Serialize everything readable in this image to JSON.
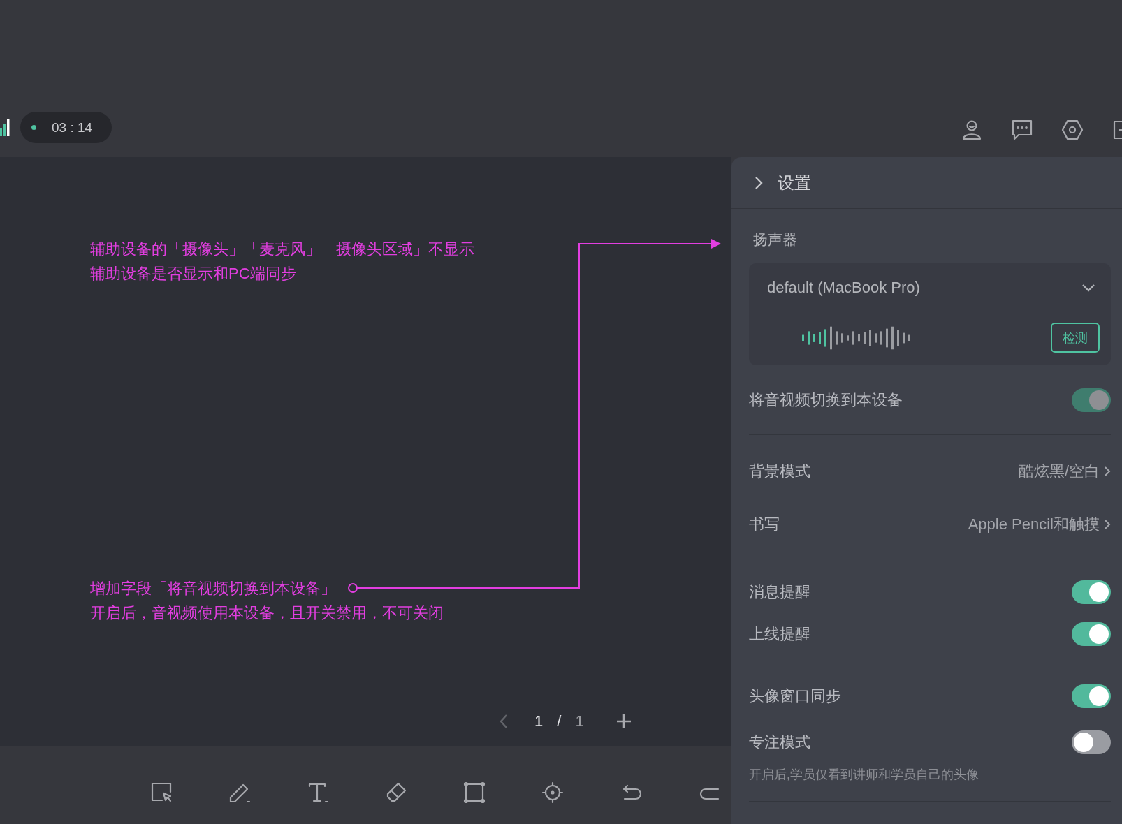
{
  "timer": {
    "time": "03 : 14"
  },
  "annotations": [
    {
      "lines": [
        "辅助设备的「摄像头」「麦克风」「摄像头区域」不显示",
        "辅助设备是否显示和PC端同步"
      ]
    },
    {
      "lines": [
        "增加字段「将音视频切换到本设备」",
        "开启后，音视频使用本设备，且开关禁用，不可关闭"
      ]
    }
  ],
  "pager": {
    "current": "1",
    "separator": "/",
    "total": "1"
  },
  "settings": {
    "title": "设置",
    "speaker": {
      "label": "扬声器",
      "device": "default (MacBook Pro)",
      "test_button": "检测"
    },
    "sections": [
      {
        "rows": [
          {
            "kind": "toggle",
            "label": "将音视频切换到本设备",
            "on": true,
            "disabled": true
          }
        ]
      },
      {
        "rows": [
          {
            "kind": "link",
            "label": "背景模式",
            "value": "酷炫黑/空白"
          },
          {
            "kind": "link",
            "label": "书写",
            "value": "Apple Pencil和触摸"
          }
        ]
      },
      {
        "rows": [
          {
            "kind": "toggle",
            "label": "消息提醒",
            "on": true,
            "disabled": false
          },
          {
            "kind": "toggle",
            "label": "上线提醒",
            "on": true,
            "disabled": false
          }
        ]
      },
      {
        "rows": [
          {
            "kind": "toggle",
            "label": "头像窗口同步",
            "on": true,
            "disabled": false
          },
          {
            "kind": "toggle",
            "label": "专注模式",
            "on": false,
            "disabled": false,
            "hint": "开启后,学员仅看到讲师和学员自己的头像"
          }
        ]
      }
    ]
  }
}
